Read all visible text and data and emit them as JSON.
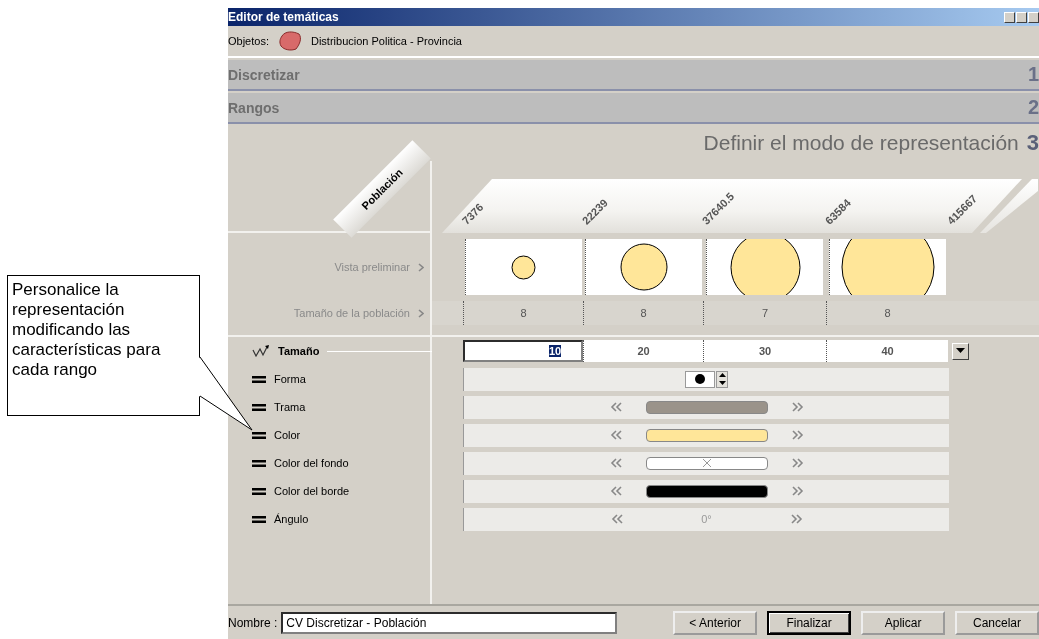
{
  "callout": {
    "text": "Personalice la representación modificando las características para cada rango"
  },
  "window": {
    "title": "Editor de temáticas"
  },
  "objects": {
    "label": "Objetos:",
    "value": "Distribucion Politica - Provincia"
  },
  "steps": [
    {
      "label": "Discretizar",
      "number": "1"
    },
    {
      "label": "Rangos",
      "number": "2"
    }
  ],
  "current_step": {
    "label": "Definir el modo de representación",
    "number": "3"
  },
  "field_tab": {
    "label": "Población"
  },
  "range_bounds": [
    "7376",
    "22239",
    "37640.5",
    "63584",
    "415667"
  ],
  "preview": {
    "label": "Vista preliminar"
  },
  "population": {
    "label": "Tamaño de la población",
    "counts": [
      "8",
      "8",
      "7",
      "8"
    ]
  },
  "properties": [
    {
      "label": "Tamaño",
      "varies": true,
      "kind": "size",
      "values": [
        {
          "text": "10",
          "selected": true
        },
        {
          "text": "20",
          "selected": false
        },
        {
          "text": "30",
          "selected": false
        },
        {
          "text": "40",
          "selected": false
        }
      ]
    },
    {
      "label": "Forma",
      "varies": false,
      "kind": "shape"
    },
    {
      "label": "Trama",
      "varies": false,
      "kind": "swatch",
      "color": "#9a938a"
    },
    {
      "label": "Color",
      "varies": false,
      "kind": "swatch",
      "color": "#ffe699"
    },
    {
      "label": "Color del fondo",
      "varies": false,
      "kind": "empty"
    },
    {
      "label": "Color del borde",
      "varies": false,
      "kind": "swatch",
      "color": "#000000"
    },
    {
      "label": "Ángulo",
      "varies": false,
      "kind": "text",
      "value": "0°"
    }
  ],
  "name_field": {
    "label": "Nombre :",
    "value": "CV Discretizar - Población"
  },
  "buttons": [
    {
      "label": "< Anterior",
      "default": false
    },
    {
      "label": "Finalizar",
      "default": true
    },
    {
      "label": "Aplicar",
      "default": false
    },
    {
      "label": "Cancelar",
      "default": false
    }
  ]
}
